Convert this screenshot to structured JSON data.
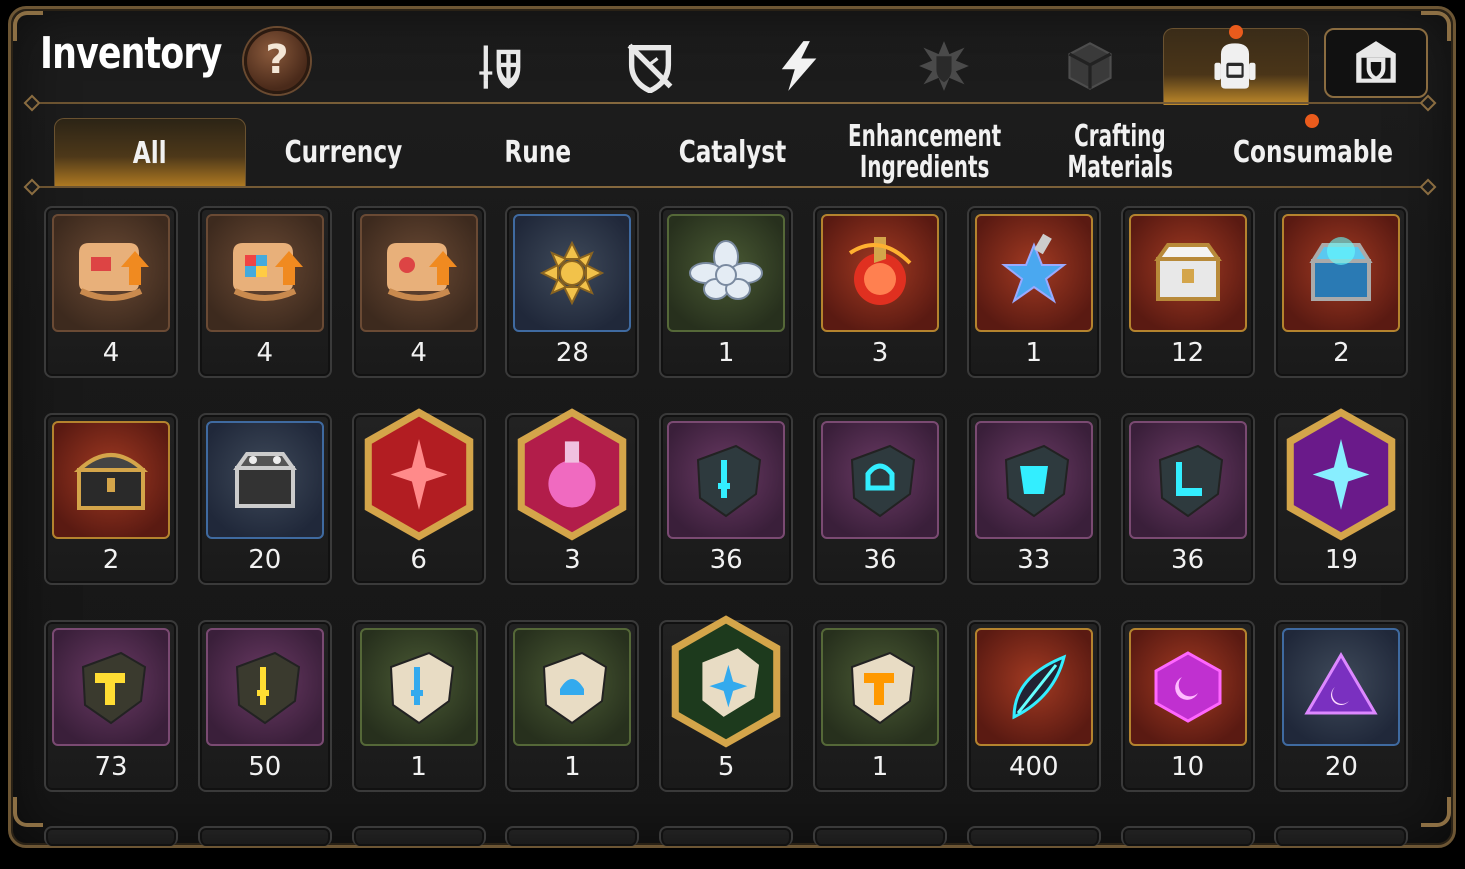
{
  "header": {
    "title": "Inventory",
    "help_label": "?"
  },
  "categories": [
    {
      "name": "knight-shield-icon"
    },
    {
      "name": "broken-shield-icon"
    },
    {
      "name": "lightning-icon"
    },
    {
      "name": "spiky-emblem-icon"
    },
    {
      "name": "cube-icon"
    },
    {
      "name": "backpack-icon",
      "active": true
    },
    {
      "name": "castle-shield-icon"
    }
  ],
  "tabs": {
    "all": "All",
    "currency": "Currency",
    "rune": "Rune",
    "catalyst": "Catalyst",
    "enhancement_1": "Enhancement",
    "enhancement_2": "Ingredients",
    "crafting_1": "Crafting",
    "crafting_2": "Materials",
    "consumable": "Consumable"
  },
  "items": [
    {
      "icon": "upgrade-scroll-fire-icon",
      "count": "4"
    },
    {
      "icon": "upgrade-scroll-rainbow-icon",
      "count": "4"
    },
    {
      "icon": "upgrade-scroll-seal-icon",
      "count": "4"
    },
    {
      "icon": "gold-flower-crystal-icon",
      "count": "28"
    },
    {
      "icon": "silver-flower-crystal-icon",
      "count": "1"
    },
    {
      "icon": "red-potion-icon",
      "count": "3"
    },
    {
      "icon": "blue-star-potion-icon",
      "count": "1"
    },
    {
      "icon": "gold-silver-chest-icon",
      "count": "12"
    },
    {
      "icon": "blue-glowing-chest-icon",
      "count": "2"
    },
    {
      "icon": "black-gold-chest-icon",
      "count": "2"
    },
    {
      "icon": "silver-dark-chest-icon",
      "count": "20"
    },
    {
      "icon": "red-star-crystal-icon",
      "count": "6"
    },
    {
      "icon": "pink-potion-crystal-icon",
      "count": "3"
    },
    {
      "icon": "cyan-sword-stone-icon",
      "count": "36"
    },
    {
      "icon": "cyan-helmet-stone-icon",
      "count": "36"
    },
    {
      "icon": "cyan-armor-stone-icon",
      "count": "33"
    },
    {
      "icon": "cyan-boots-stone-icon",
      "count": "36"
    },
    {
      "icon": "purple-star-crystal-icon",
      "count": "19"
    },
    {
      "icon": "yellow-hammer-stone-icon",
      "count": "73"
    },
    {
      "icon": "yellow-sword-stone-icon",
      "count": "50"
    },
    {
      "icon": "pale-sword-stone-icon",
      "count": "1"
    },
    {
      "icon": "pale-helmet-stone-icon",
      "count": "1"
    },
    {
      "icon": "pale-star-stone-icon",
      "count": "5"
    },
    {
      "icon": "pale-hammer-stone-icon",
      "count": "1"
    },
    {
      "icon": "dark-feather-icon",
      "count": "400"
    },
    {
      "icon": "purple-moon-gem-icon",
      "count": "10"
    },
    {
      "icon": "purple-moon-prism-icon",
      "count": "20"
    }
  ]
}
